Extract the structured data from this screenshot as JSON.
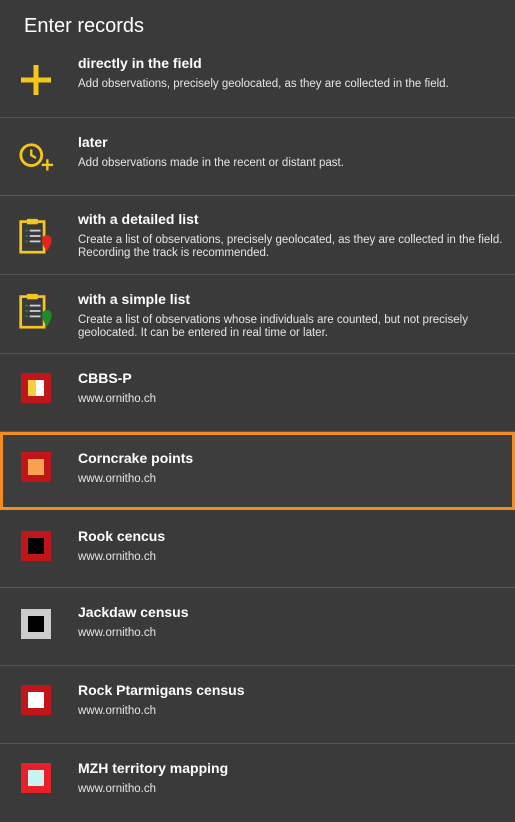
{
  "header": {
    "title": "Enter records"
  },
  "items": [
    {
      "title": "directly in the field",
      "desc": "Add observations, precisely geolocated, as they are collected in the field.",
      "icon": "plus-icon"
    },
    {
      "title": "later",
      "desc": "Add observations made in the recent or distant past.",
      "icon": "clock-plus-icon"
    },
    {
      "title": "with a detailed list",
      "desc": "Create a list of observations, precisely geolocated, as they are collected in the field. Recording the track is recommended.",
      "icon": "clipboard-red-pin-icon"
    },
    {
      "title": "with a simple list",
      "desc": "Create a list of observations whose individuals are counted, but not precisely geolocated. It can be entered in real time or later.",
      "icon": "clipboard-green-pin-icon"
    },
    {
      "title": "CBBS-P",
      "desc": "www.ornitho.ch",
      "icon": "red-yellow-square-icon",
      "outer": "#c0161a",
      "inner": "#f2d23a",
      "innerAlt": "#ffffff"
    },
    {
      "title": "Corncrake points",
      "desc": "www.ornitho.ch",
      "icon": "red-orange-square-icon",
      "outer": "#c0161a",
      "inner": "#f6a24e",
      "selected": true
    },
    {
      "title": "Rook cencus",
      "desc": "www.ornitho.ch",
      "icon": "red-black-square-icon",
      "outer": "#c0161a",
      "inner": "#000000"
    },
    {
      "title": "Jackdaw census",
      "desc": "www.ornitho.ch",
      "icon": "grey-black-square-icon",
      "outer": "#cccccc",
      "inner": "#000000"
    },
    {
      "title": "Rock Ptarmigans census",
      "desc": "www.ornitho.ch",
      "icon": "red-white-square-icon",
      "outer": "#c0161a",
      "inner": "#ffffff"
    },
    {
      "title": "MZH territory mapping",
      "desc": "www.ornitho.ch",
      "icon": "red-cyan-square-icon",
      "outer": "#e8202a",
      "inner": "#c9f2f2"
    }
  ],
  "colors": {
    "accent": "#f28e1f",
    "background": "#3a3a3a",
    "icon_yellow": "#f6c61a"
  }
}
